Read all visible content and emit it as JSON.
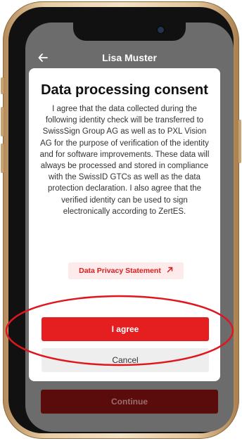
{
  "header": {
    "title": "Lisa Muster"
  },
  "background": {
    "continue_label": "Continue"
  },
  "modal": {
    "title": "Data processing consent",
    "body": "I agree that the data collected during the following identity check will be transferred to SwissSign Group AG as well as to PXL Vision AG for the purpose of verification of the identity and for software improvements. These data will always be processed and stored in compliance with the SwissID GTCs as well as the data protection declaration. I also agree that the verified identity can be used to sign electronically according to ZertES.",
    "privacy_link_label": "Data Privacy Statement",
    "agree_label": "I agree",
    "cancel_label": "Cancel"
  },
  "colors": {
    "accent": "#e51f1f",
    "highlight_ring": "#e0161e",
    "overlay": "#6c6c6c"
  },
  "icons": {
    "back": "arrow-left-icon",
    "external_link": "arrow-up-right-icon"
  }
}
